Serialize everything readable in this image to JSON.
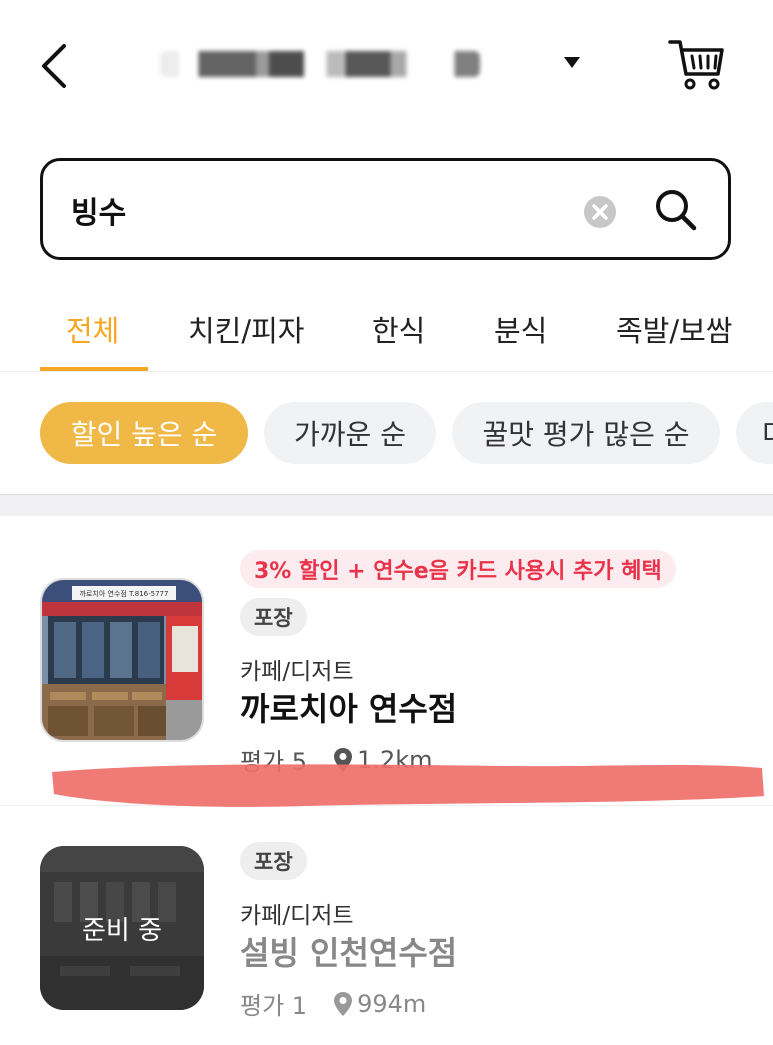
{
  "header": {
    "location_title": "",
    "back_icon": "chevron-left-icon",
    "dropdown_icon": "caret-down-icon",
    "cart_icon": "cart-icon"
  },
  "search": {
    "query": "빙수",
    "clear_icon": "clear-icon",
    "search_icon": "search-icon"
  },
  "tabs": [
    {
      "label": "전체",
      "active": true
    },
    {
      "label": "치킨/피자",
      "active": false
    },
    {
      "label": "한식",
      "active": false
    },
    {
      "label": "분식",
      "active": false
    },
    {
      "label": "족발/보쌈",
      "active": false
    }
  ],
  "sort_chips": [
    {
      "label": "할인 높은 순",
      "active": true
    },
    {
      "label": "가까운 순",
      "active": false
    },
    {
      "label": "꿀맛 평가 많은 순",
      "active": false
    },
    {
      "label": "더",
      "active": false
    }
  ],
  "stores": [
    {
      "promo": "3% 할인 + 연수e음 카드 사용시 추가 혜택",
      "tag": "포장",
      "category": "카페/디저트",
      "name": "까로치아 연수점",
      "rating_text": "평가 5",
      "distance": "1.2km",
      "sign_text": "까로치아 연수점 T.816-5777",
      "status": ""
    },
    {
      "promo": "",
      "tag": "포장",
      "category": "카페/디저트",
      "name": "설빙 인천연수점",
      "rating_text": "평가 1",
      "distance": "994m",
      "status": "준비 중"
    }
  ],
  "colors": {
    "accent": "#f5a623",
    "chip_active": "#f0b847",
    "promo_text": "#e8334a",
    "promo_bg": "#fdecef",
    "redaction": "#ef6f6a"
  }
}
